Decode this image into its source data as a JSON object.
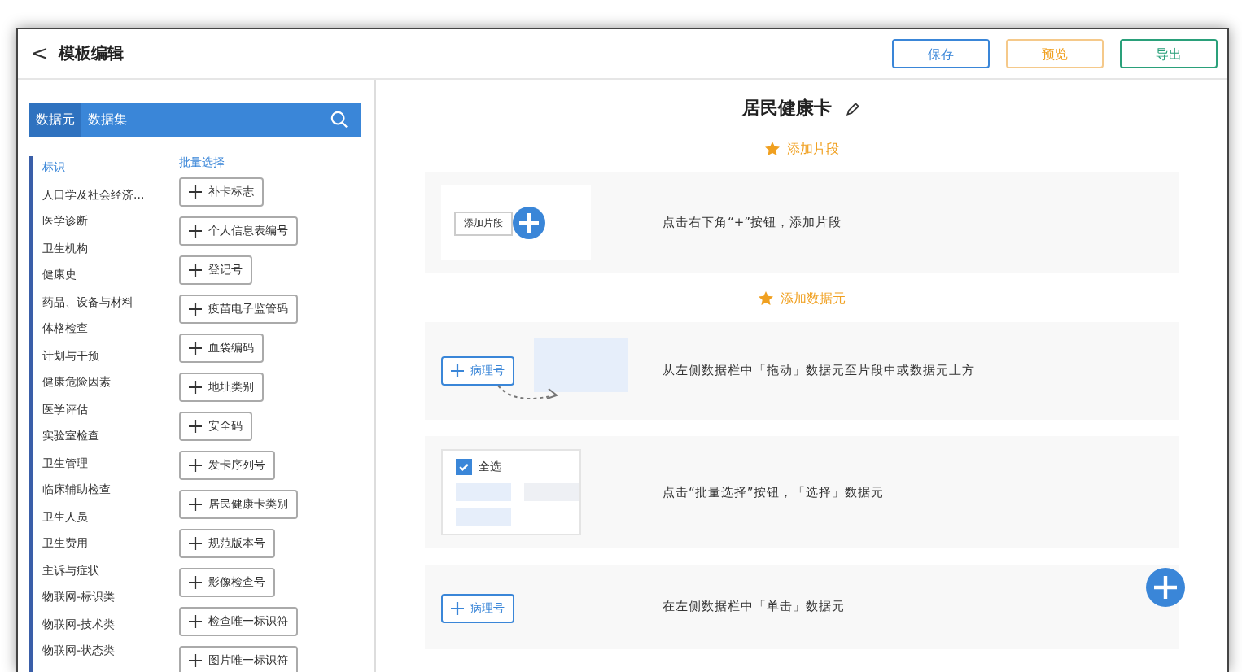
{
  "header": {
    "back": "<",
    "title": "模板编辑",
    "buttons": [
      {
        "label": "保存",
        "kind": "save"
      },
      {
        "label": "预览",
        "kind": "preview"
      },
      {
        "label": "导出",
        "kind": "export"
      }
    ]
  },
  "sidebar": {
    "tabs": [
      {
        "label": "数据元",
        "selected": true
      },
      {
        "label": "数据集",
        "selected": false
      }
    ],
    "categories": [
      {
        "label": "标识",
        "selected": true
      },
      {
        "label": "人口学及社会经济...",
        "selected": false
      },
      {
        "label": "医学诊断",
        "selected": false
      },
      {
        "label": "卫生机构",
        "selected": false
      },
      {
        "label": "健康史",
        "selected": false
      },
      {
        "label": "药品、设备与材料",
        "selected": false
      },
      {
        "label": "体格检查",
        "selected": false
      },
      {
        "label": "计划与干预",
        "selected": false
      },
      {
        "label": "健康危险因素",
        "selected": false
      },
      {
        "label": "医学评估",
        "selected": false
      },
      {
        "label": "实验室检查",
        "selected": false
      },
      {
        "label": "卫生管理",
        "selected": false
      },
      {
        "label": "临床辅助检查",
        "selected": false
      },
      {
        "label": "卫生人员",
        "selected": false
      },
      {
        "label": "卫生费用",
        "selected": false
      },
      {
        "label": "主诉与症状",
        "selected": false
      },
      {
        "label": "物联网-标识类",
        "selected": false
      },
      {
        "label": "物联网-技术类",
        "selected": false
      },
      {
        "label": "物联网-状态类",
        "selected": false
      }
    ],
    "batch_select": "批量选择",
    "elements": [
      "补卡标志",
      "个人信息表编号",
      "登记号",
      "疫苗电子监管码",
      "血袋编码",
      "地址类别",
      "安全码",
      "发卡序列号",
      "居民健康卡类别",
      "规范版本号",
      "影像检查号",
      "检查唯一标识符",
      "图片唯一标识符"
    ]
  },
  "canvas": {
    "title": "居民健康卡",
    "steps": [
      {
        "heading": "添加片段",
        "kind": "add-segment",
        "demo_label": "添加片段",
        "text": "点击右下角“+”按钮，添加片段"
      },
      {
        "heading": "添加数据元",
        "kind": "drag",
        "demo_label": "病理号",
        "text": "从左侧数据栏中「拖动」数据元至片段中或数据元上方"
      },
      {
        "kind": "select",
        "demo_label": "全选",
        "checked": true,
        "text": "点击“批量选择”按钮，「选择」数据元"
      },
      {
        "kind": "click",
        "demo_label": "病理号",
        "text": "在左侧数据栏中「单击」数据元"
      }
    ]
  }
}
